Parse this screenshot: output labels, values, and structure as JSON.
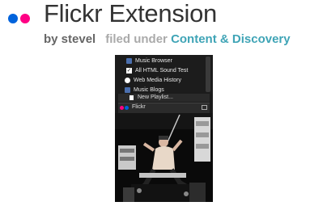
{
  "header": {
    "title": "Flickr Extension",
    "by": "by stevel",
    "filed": "filed under",
    "category": "Content & Discovery"
  },
  "screenshot": {
    "menu_items": [
      {
        "label": "Music Browser",
        "icon": "folder-icon"
      },
      {
        "label": "All HTML Sound Test",
        "icon": "check-icon"
      },
      {
        "label": "Web Media History",
        "icon": "play-icon"
      },
      {
        "label": "Music Blogs",
        "icon": "folder-icon"
      }
    ],
    "new_playlist": "New Playlist...",
    "panel_title": "Flickr"
  },
  "colors": {
    "flickr_blue": "#0063dc",
    "flickr_pink": "#ff0084",
    "category_link": "#3fa4b6"
  }
}
